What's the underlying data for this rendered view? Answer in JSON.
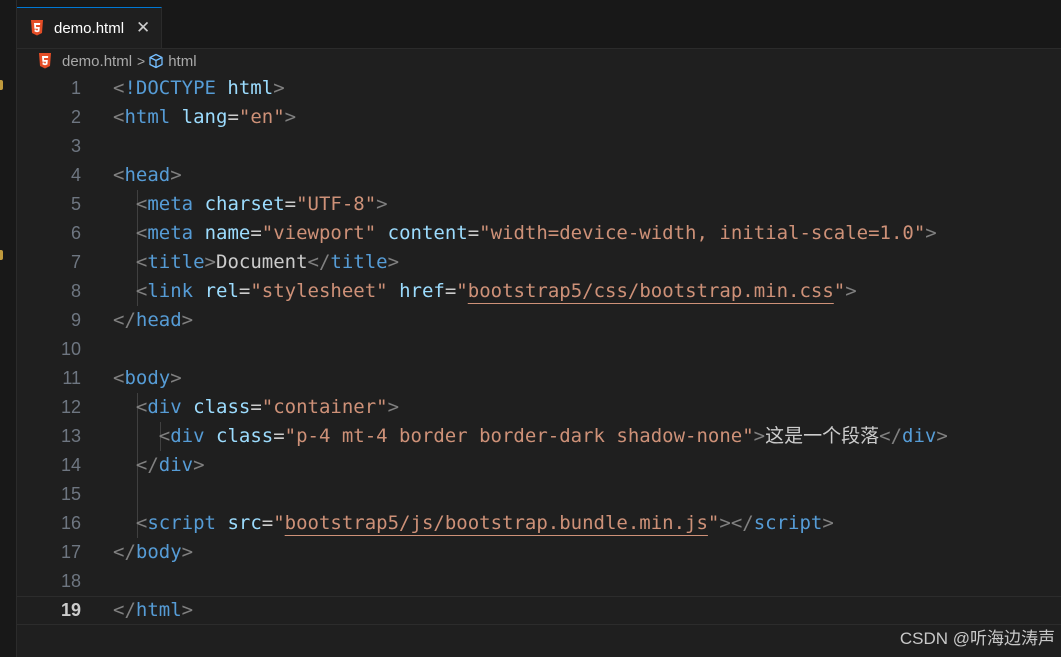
{
  "tab": {
    "label": "demo.html",
    "close": "✕",
    "icon": "html5-icon"
  },
  "breadcrumb": {
    "file": "demo.html",
    "separator": ">",
    "symbol": "html"
  },
  "watermark": "CSDN @听海边涛声",
  "current_line": 19,
  "lines": [
    {
      "n": "1",
      "tokens": [
        [
          "b",
          "<"
        ],
        [
          "doc",
          "!DOCTYPE"
        ],
        [
          "p",
          " "
        ],
        [
          "doc-kw",
          "html"
        ],
        [
          "b",
          ">"
        ]
      ]
    },
    {
      "n": "2",
      "tokens": [
        [
          "b",
          "<"
        ],
        [
          "t",
          "html"
        ],
        [
          "p",
          " "
        ],
        [
          "a",
          "lang"
        ],
        [
          "p",
          "="
        ],
        [
          "s",
          "\"en\""
        ],
        [
          "b",
          ">"
        ]
      ]
    },
    {
      "n": "3",
      "tokens": []
    },
    {
      "n": "4",
      "tokens": [
        [
          "b",
          "<"
        ],
        [
          "t",
          "head"
        ],
        [
          "b",
          ">"
        ]
      ]
    },
    {
      "n": "5",
      "tokens": [
        [
          "p",
          "  "
        ],
        [
          "b",
          "<"
        ],
        [
          "t",
          "meta"
        ],
        [
          "p",
          " "
        ],
        [
          "a",
          "charset"
        ],
        [
          "p",
          "="
        ],
        [
          "s",
          "\"UTF-8\""
        ],
        [
          "b",
          ">"
        ]
      ]
    },
    {
      "n": "6",
      "tokens": [
        [
          "p",
          "  "
        ],
        [
          "b",
          "<"
        ],
        [
          "t",
          "meta"
        ],
        [
          "p",
          " "
        ],
        [
          "a",
          "name"
        ],
        [
          "p",
          "="
        ],
        [
          "s",
          "\"viewport\""
        ],
        [
          "p",
          " "
        ],
        [
          "a",
          "content"
        ],
        [
          "p",
          "="
        ],
        [
          "s",
          "\"width=device-width, initial-scale=1.0\""
        ],
        [
          "b",
          ">"
        ]
      ]
    },
    {
      "n": "7",
      "tokens": [
        [
          "p",
          "  "
        ],
        [
          "b",
          "<"
        ],
        [
          "t",
          "title"
        ],
        [
          "b",
          ">"
        ],
        [
          "p",
          "Document"
        ],
        [
          "b",
          "</"
        ],
        [
          "t",
          "title"
        ],
        [
          "b",
          ">"
        ]
      ]
    },
    {
      "n": "8",
      "tokens": [
        [
          "p",
          "  "
        ],
        [
          "b",
          "<"
        ],
        [
          "t",
          "link"
        ],
        [
          "p",
          " "
        ],
        [
          "a",
          "rel"
        ],
        [
          "p",
          "="
        ],
        [
          "s",
          "\"stylesheet\""
        ],
        [
          "p",
          " "
        ],
        [
          "a",
          "href"
        ],
        [
          "p",
          "="
        ],
        [
          "s",
          "\""
        ],
        [
          "u",
          "bootstrap5/css/bootstrap.min.css"
        ],
        [
          "s",
          "\""
        ],
        [
          "b",
          ">"
        ]
      ]
    },
    {
      "n": "9",
      "tokens": [
        [
          "b",
          "</"
        ],
        [
          "t",
          "head"
        ],
        [
          "b",
          ">"
        ]
      ]
    },
    {
      "n": "10",
      "tokens": []
    },
    {
      "n": "11",
      "tokens": [
        [
          "b",
          "<"
        ],
        [
          "t",
          "body"
        ],
        [
          "b",
          ">"
        ]
      ]
    },
    {
      "n": "12",
      "tokens": [
        [
          "p",
          "  "
        ],
        [
          "b",
          "<"
        ],
        [
          "t",
          "div"
        ],
        [
          "p",
          " "
        ],
        [
          "a",
          "class"
        ],
        [
          "p",
          "="
        ],
        [
          "s",
          "\"container\""
        ],
        [
          "b",
          ">"
        ]
      ]
    },
    {
      "n": "13",
      "tokens": [
        [
          "p",
          "    "
        ],
        [
          "b",
          "<"
        ],
        [
          "t",
          "div"
        ],
        [
          "p",
          " "
        ],
        [
          "a",
          "class"
        ],
        [
          "p",
          "="
        ],
        [
          "s",
          "\"p-4 mt-4 border border-dark shadow-none\""
        ],
        [
          "b",
          ">"
        ],
        [
          "p",
          "这是一个段落"
        ],
        [
          "b",
          "</"
        ],
        [
          "t",
          "div"
        ],
        [
          "b",
          ">"
        ]
      ]
    },
    {
      "n": "14",
      "tokens": [
        [
          "p",
          "  "
        ],
        [
          "b",
          "</"
        ],
        [
          "t",
          "div"
        ],
        [
          "b",
          ">"
        ]
      ]
    },
    {
      "n": "15",
      "tokens": []
    },
    {
      "n": "16",
      "tokens": [
        [
          "p",
          "  "
        ],
        [
          "b",
          "<"
        ],
        [
          "t",
          "script"
        ],
        [
          "p",
          " "
        ],
        [
          "a",
          "src"
        ],
        [
          "p",
          "="
        ],
        [
          "s",
          "\""
        ],
        [
          "u",
          "bootstrap5/js/bootstrap.bundle.min.js"
        ],
        [
          "s",
          "\""
        ],
        [
          "b",
          "></"
        ],
        [
          "t",
          "script"
        ],
        [
          "b",
          ">"
        ]
      ]
    },
    {
      "n": "17",
      "tokens": [
        [
          "b",
          "</"
        ],
        [
          "t",
          "body"
        ],
        [
          "b",
          ">"
        ]
      ]
    },
    {
      "n": "18",
      "tokens": []
    },
    {
      "n": "19",
      "tokens": [
        [
          "b",
          "</"
        ],
        [
          "t",
          "html"
        ],
        [
          "b",
          ">"
        ]
      ]
    }
  ]
}
